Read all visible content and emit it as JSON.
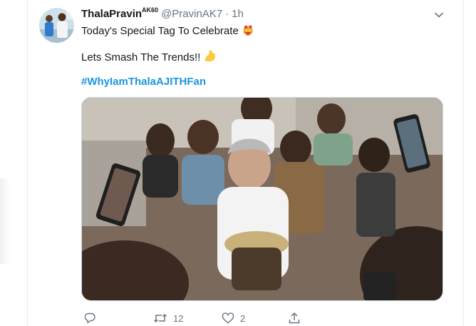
{
  "tweet": {
    "author": {
      "display_name": "ThalaPravin",
      "display_name_sup": "AK60",
      "handle": "@PravinAK7",
      "separator": "·",
      "time": "1h"
    },
    "text_line1": "Today's Special Tag To Celebrate",
    "text_line2": "Lets Smash The Trends!!",
    "hashtag": "#WhyIamThalaAJITHFan",
    "icons": {
      "line1_emoji": "celebration-emoji-icon",
      "line2_emoji": "flexed-biceps-emoji-icon",
      "menu": "chevron-down-icon"
    },
    "actions": {
      "reply": {
        "icon": "reply-icon",
        "count": ""
      },
      "retweet": {
        "icon": "retweet-icon",
        "count": "12"
      },
      "like": {
        "icon": "heart-icon",
        "count": "2"
      },
      "share": {
        "icon": "share-icon",
        "count": ""
      }
    }
  },
  "colors": {
    "link": "#1b95e0",
    "secondary_text": "#657786",
    "primary_text": "#14171a",
    "divider": "#e6ecf0"
  }
}
